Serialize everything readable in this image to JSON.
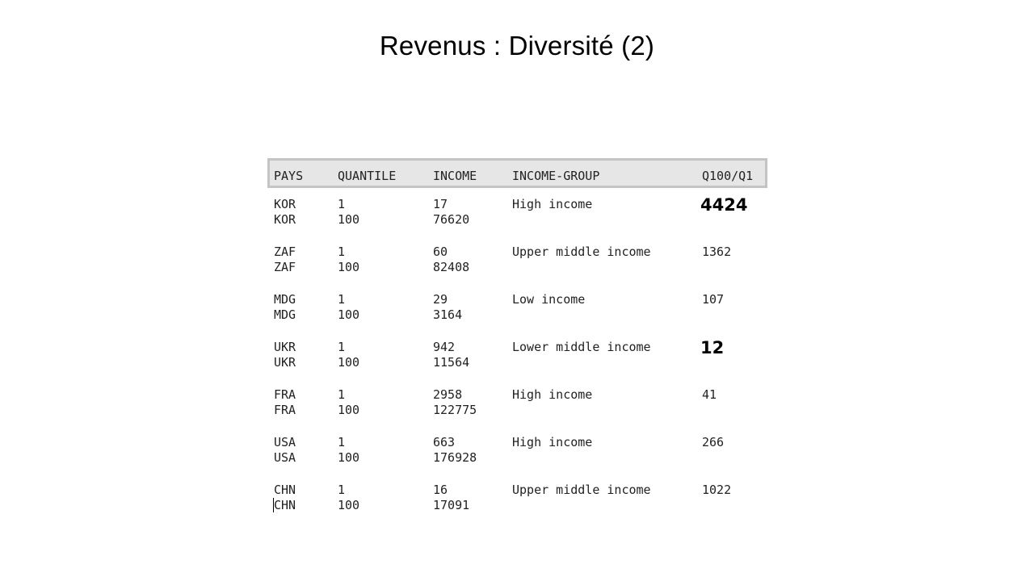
{
  "slide": {
    "title": "Revenus :  Diversité (2)"
  },
  "table": {
    "headers": [
      "PAYS",
      "QUANTILE",
      "INCOME",
      "INCOME-GROUP",
      "Q100/Q1"
    ],
    "rows": [
      {
        "country": "KOR",
        "quantiles": [
          "1",
          "100"
        ],
        "incomes": [
          "17",
          "76620"
        ],
        "income_group": "High income",
        "ratio": "4424",
        "emphasized": true
      },
      {
        "country": "ZAF",
        "quantiles": [
          "1",
          "100"
        ],
        "incomes": [
          "60",
          "82408"
        ],
        "income_group": "Upper middle income",
        "ratio": "1362",
        "emphasized": false
      },
      {
        "country": "MDG",
        "quantiles": [
          "1",
          "100"
        ],
        "incomes": [
          "29",
          "3164"
        ],
        "income_group": "Low income",
        "ratio": "107",
        "emphasized": false
      },
      {
        "country": "UKR",
        "quantiles": [
          "1",
          "100"
        ],
        "incomes": [
          "942",
          "11564"
        ],
        "income_group": "Lower middle income",
        "ratio": "12",
        "emphasized": true
      },
      {
        "country": "FRA",
        "quantiles": [
          "1",
          "100"
        ],
        "incomes": [
          "2958",
          "122775"
        ],
        "income_group": "High income",
        "ratio": "41",
        "emphasized": false
      },
      {
        "country": "USA",
        "quantiles": [
          "1",
          "100"
        ],
        "incomes": [
          "663",
          "176928"
        ],
        "income_group": "High income",
        "ratio": "266",
        "emphasized": false
      },
      {
        "country": "CHN",
        "quantiles": [
          "1",
          "100"
        ],
        "incomes": [
          "16",
          "17091"
        ],
        "income_group": "Upper middle income",
        "ratio": "1022",
        "emphasized": false
      }
    ]
  }
}
